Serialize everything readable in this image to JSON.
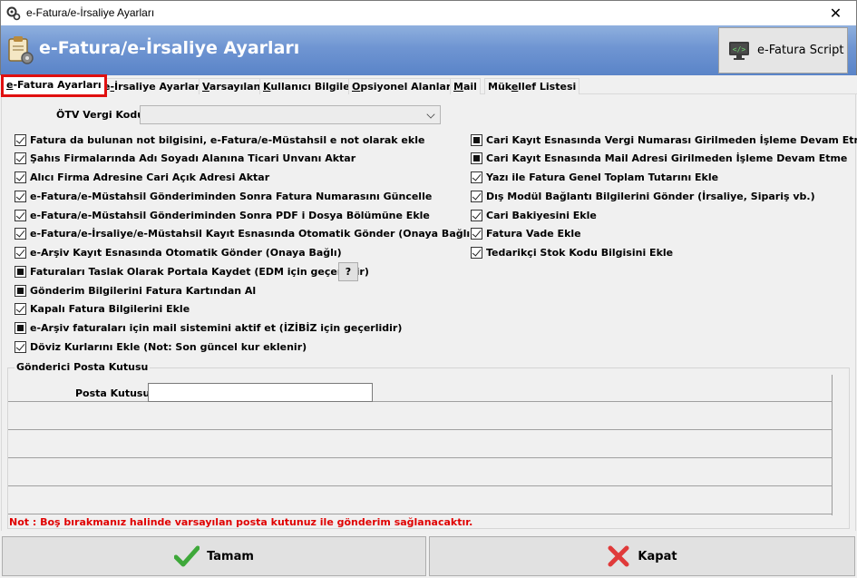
{
  "window": {
    "title": "e-Fatura/e-İrsaliye Ayarları",
    "close_glyph": "✕"
  },
  "banner": {
    "title": "e-Fatura/e-İrsaliye Ayarları",
    "script_button": "e-Fatura Script"
  },
  "tabs": [
    {
      "label_prefix": "",
      "label_u": "e",
      "label_rest": "-Fatura Ayarları",
      "active": true
    },
    {
      "label_prefix": "e",
      "label_u": "-",
      "label_rest": "İrsaliye Ayarları",
      "active": false
    },
    {
      "label_prefix": "",
      "label_u": "V",
      "label_rest": "arsayılan",
      "active": false
    },
    {
      "label_prefix": "",
      "label_u": "K",
      "label_rest": "ullanıcı Bilgileri",
      "active": false
    },
    {
      "label_prefix": "",
      "label_u": "O",
      "label_rest": "psiyonel Alanlar",
      "active": false
    },
    {
      "label_prefix": "",
      "label_u": "M",
      "label_rest": "ail",
      "active": false
    },
    {
      "label_prefix": "Mük",
      "label_u": "e",
      "label_rest": "llef Listesi",
      "active": false
    }
  ],
  "otv": {
    "label": "ÖTV Vergi Kodu",
    "value": ""
  },
  "left_options": [
    {
      "label": "Fatura da bulunan not bilgisini, e-Fatura/e-Müstahsil e not olarak ekle",
      "state": "checked"
    },
    {
      "label": "Şahıs Firmalarında Adı Soyadı Alanına Ticari Unvanı Aktar",
      "state": "checked"
    },
    {
      "label": "Alıcı Firma Adresine Cari Açık Adresi Aktar",
      "state": "checked"
    },
    {
      "label": "e-Fatura/e-Müstahsil Gönderiminden Sonra Fatura Numarasını Güncelle",
      "state": "checked"
    },
    {
      "label": "e-Fatura/e-Müstahsil Gönderiminden Sonra PDF i Dosya Bölümüne Ekle",
      "state": "checked"
    },
    {
      "label": "e-Fatura/e-İrsaliye/e-Müstahsil Kayıt Esnasında Otomatik Gönder (Onaya Bağlı)",
      "state": "checked"
    },
    {
      "label": "e-Arşiv Kayıt Esnasında Otomatik Gönder (Onaya Bağlı)",
      "state": "checked"
    },
    {
      "label": "Faturaları Taslak Olarak Portala Kaydet (EDM için geçerlidir)",
      "state": "indeterminate"
    },
    {
      "label": "Gönderim Bilgilerini Fatura Kartından Al",
      "state": "indeterminate"
    },
    {
      "label": "Kapalı Fatura Bilgilerini Ekle",
      "state": "checked"
    },
    {
      "label": "e-Arşiv faturaları için mail sistemini aktif et (İZİBİZ için geçerlidir)",
      "state": "indeterminate"
    },
    {
      "label": "Döviz Kurlarını Ekle (Not: Son güncel kur eklenir)",
      "state": "checked"
    }
  ],
  "right_options": [
    {
      "label": "Cari Kayıt Esnasında Vergi Numarası Girilmeden İşleme Devam Etme",
      "state": "indeterminate"
    },
    {
      "label": "Cari Kayıt Esnasında Mail Adresi Girilmeden İşleme Devam Etme",
      "state": "indeterminate"
    },
    {
      "label": "Yazı ile Fatura Genel Toplam Tutarını Ekle",
      "state": "checked"
    },
    {
      "label": "Dış Modül Bağlantı Bilgilerini Gönder (İrsaliye, Sipariş vb.)",
      "state": "checked"
    },
    {
      "label": "Cari Bakiyesini Ekle",
      "state": "checked"
    },
    {
      "label": "Fatura Vade Ekle",
      "state": "checked"
    },
    {
      "label": "Tedarikçi Stok Kodu Bilgisini Ekle",
      "state": "checked"
    }
  ],
  "help_button": "?",
  "mailbox_group": {
    "title": "Gönderici Posta Kutusu",
    "field_label": "Posta Kutusu",
    "field_value": "",
    "note": "Not : Boş bırakmanız halinde varsayılan posta kutunuz ile gönderim sağlanacaktır."
  },
  "buttons": {
    "ok": "Tamam",
    "close": "Kapat"
  },
  "colors": {
    "banner": "#6f95d2",
    "active_tab_outline": "#e01010",
    "note": "#e00000",
    "ok_icon": "#3ea83a",
    "close_icon": "#e03a3a"
  }
}
